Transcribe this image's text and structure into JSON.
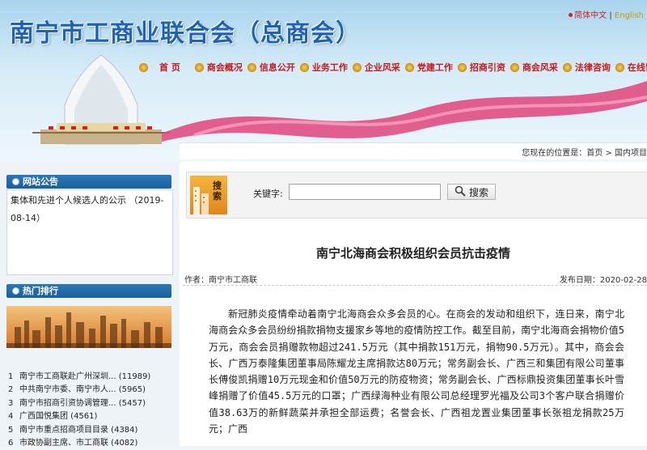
{
  "header": {
    "title": "南宁市工商业联合会（总商会）",
    "lang_cn": "简体中文",
    "lang_en": "English"
  },
  "nav": [
    {
      "label": "首 页"
    },
    {
      "label": "商会概况"
    },
    {
      "label": "信息公开"
    },
    {
      "label": "业务工作"
    },
    {
      "label": "企业风采"
    },
    {
      "label": "党建工作"
    },
    {
      "label": "招商引资"
    },
    {
      "label": "商会风采"
    },
    {
      "label": "法律咨询"
    },
    {
      "label": "在线留言"
    }
  ],
  "breadcrumb": "您现在的位置是：首页 > 国内项目",
  "sidebar": {
    "notice_title": "网站公告",
    "notice_text": "集体和先进个人候选人的公示 （2019-08-14）",
    "hot_title": "热门排行",
    "hot_items": [
      {
        "num": "1",
        "text": "南宁市工商联赴广州深圳... (11989)"
      },
      {
        "num": "2",
        "text": "中共南宁市委、南宁市人... (5965)"
      },
      {
        "num": "3",
        "text": "南宁市招商引资协调管理... (5457)"
      },
      {
        "num": "4",
        "text": "广西国悦集团 (4561)"
      },
      {
        "num": "5",
        "text": "南宁市重点招商项目目录 (4384)"
      },
      {
        "num": "6",
        "text": "市政协副主席、市工商联 (4082)"
      }
    ]
  },
  "search": {
    "tag": "搜索",
    "label": "关键字:",
    "value": "",
    "button": "搜索"
  },
  "article": {
    "title": "南宁北海商会积极组织会员抗击疫情",
    "author": "作者：南宁市工商联",
    "date": "发布日期：2020-02-28",
    "body": "新冠肺炎疫情牵动着南宁北海商会众多会员的心。在商会的发动和组织下，连日来，南宁北海商会众多会员纷纷捐款捐物支援家乡等地的疫情防控工作。截至目前，南宁北海商会捐物价值5万元，商会会员捐赠款物超过241.5万元（其中捐款151万元，捐物90.5万元）。其中，商会会长、广西万泰隆集团董事局陈耀龙主席捐款达80万元；常务副会长、广西三和集团有限公司董事长傅俊凯捐赠10万元现金和价值50万元的防疫物资；常务副会长、广西标鼎投资集团董事长叶雪峰捐赠了价值45.5万元的口罩；广西绿海种业有限公司总经理罗光福及公司3个客户联合捐赠价值38.63万的新鲜蔬菜并承担全部运费；名誉会长、广西祖龙置业集团董事长张祖龙捐款25万元；广西"
  }
}
